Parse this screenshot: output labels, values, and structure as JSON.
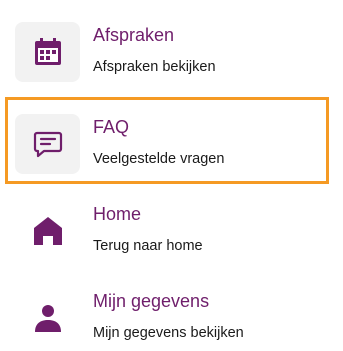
{
  "menu": {
    "items": [
      {
        "icon": "calendar-icon",
        "title": "Afspraken",
        "subtitle": "Afspraken bekijken",
        "focused": false
      },
      {
        "icon": "chat-bubble-icon",
        "title": "FAQ",
        "subtitle": "Veelgestelde vragen",
        "focused": true
      },
      {
        "icon": "home-icon",
        "title": "Home",
        "subtitle": "Terug naar home",
        "focused": false
      },
      {
        "icon": "user-icon",
        "title": "Mijn gegevens",
        "subtitle": "Mijn gegevens bekijken",
        "focused": false
      }
    ]
  },
  "colors": {
    "accent": "#6f1e6b",
    "focus": "#f59a23",
    "icon_bg": "#f2f2f2",
    "text": "#1a1a1a"
  }
}
